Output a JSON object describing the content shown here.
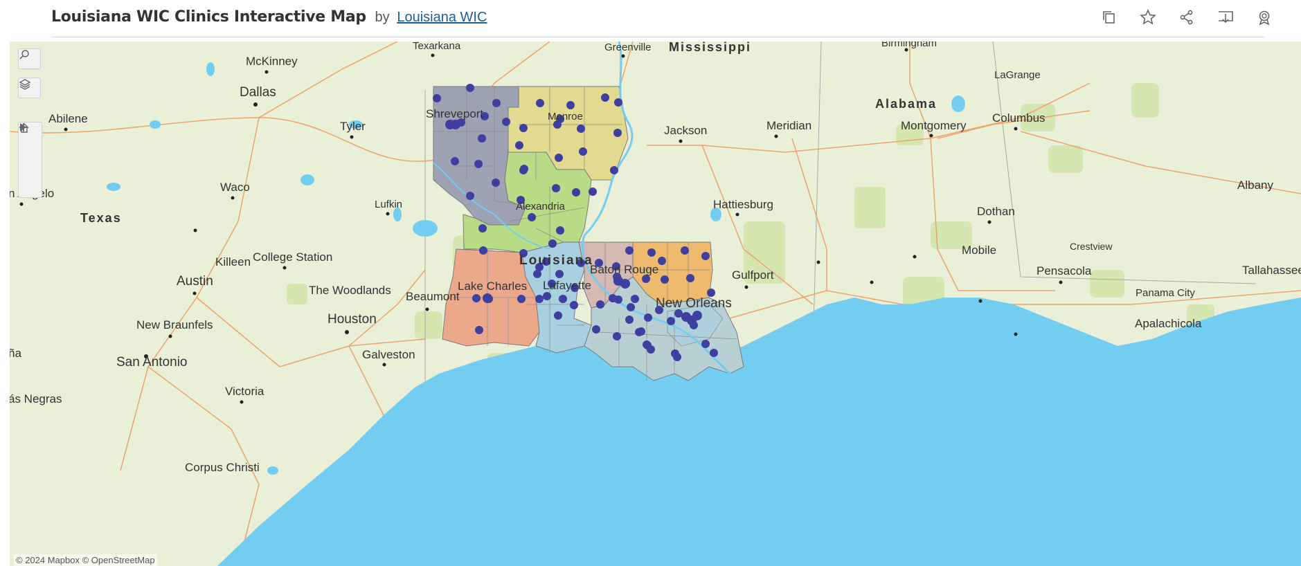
{
  "header": {
    "title": "Louisiana WIC Clinics Interactive Map",
    "by": "by",
    "author": "Louisiana WIC",
    "icons": [
      "duplicate-icon",
      "star-icon",
      "share-icon",
      "download-icon",
      "badge-icon"
    ]
  },
  "controls": [
    "search-icon",
    "layers-icon",
    "zoom-in-icon",
    "zoom-out-icon",
    "home-icon",
    "play-icon"
  ],
  "colors": {
    "water": "#73cdf0",
    "land": "#eaf0d8",
    "clinic_dot": "#3f3fa0",
    "region_1": "#9ea3b4",
    "region_2": "#e2da8e",
    "region_3": "#b8db86",
    "region_4": "#eca88a",
    "region_5": "#a9d0e0",
    "region_6": "#d5b9b4",
    "region_7": "#eeba6d",
    "region_9": "#b8cfd4"
  },
  "labels": {
    "states": {
      "texas": "Texas",
      "louisiana": "Louisiana",
      "mississippi": "Mississippi",
      "alabama": "Alabama"
    },
    "cities": {
      "texarkana": "Texarkana",
      "greenville": "Greenville",
      "birmingham": "Birmingham",
      "lagrange": "LaGrange",
      "mckinney": "McKinney",
      "dallas": "Dallas",
      "abilene": "Abilene",
      "tyler": "Tyler",
      "shreveport": "Shreveport",
      "monroe": "Monroe",
      "jackson": "Jackson",
      "meridian": "Meridian",
      "montgomery": "Montgomery",
      "columbus": "Columbus",
      "san_angelo": "n Angelo",
      "waco": "Waco",
      "lufkin": "Lufkin",
      "alexandria": "Alexandria",
      "albany": "Albany",
      "killeen": "Killeen",
      "hattiesburg": "Hattiesburg",
      "dothan": "Dothan",
      "college_station": "College Station",
      "mobile": "Mobile",
      "crestview": "Crestview",
      "austin": "Austin",
      "baton_rouge": "Baton Rouge",
      "pensacola": "Pensacola",
      "tallahassee": "Tallahassee",
      "lake_charles": "Lake Charles",
      "gulfport": "Gulfport",
      "the_woodlands": "The Woodlands",
      "lafayette": "Lafayette",
      "panama_city": "Panama City",
      "beaumont": "Beaumont",
      "new_orleans": "New Orleans",
      "new_braunfels": "New Braunfels",
      "houston": "Houston",
      "apalachicola": "Apalachicola",
      "ona": "ña",
      "san_antonio": "San Antonio",
      "galveston": "Galveston",
      "victoria": "Victoria",
      "piedras_negras": "ás Negras",
      "corpus_christi": "Corpus Christi"
    }
  },
  "attribution": "© 2024 Mapbox  © OpenStreetMap"
}
